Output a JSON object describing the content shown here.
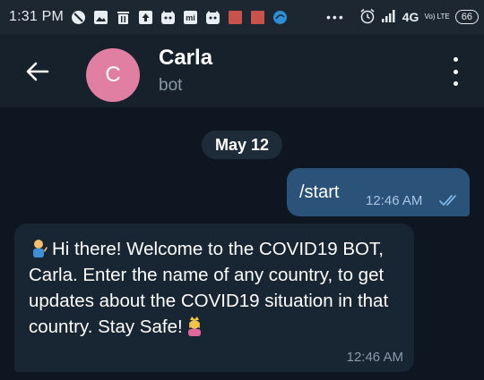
{
  "status_bar": {
    "time": "1:31 PM",
    "icons": [
      "blocked-icon",
      "gallery-icon",
      "trash-icon",
      "upload-icon",
      "cat-icon",
      "mi-icon",
      "cat-icon",
      "red-square-icon",
      "red-square-icon",
      "blue-circle-icon"
    ],
    "more": "•••",
    "network": "4G",
    "volte": "Vo) LTE",
    "battery": "66"
  },
  "header": {
    "avatar_letter": "C",
    "title": "Carla",
    "subtitle": "bot",
    "avatar_color": "#e17fa2"
  },
  "chat": {
    "date_chip": "May 12",
    "messages": [
      {
        "direction": "out",
        "text": "/start",
        "time": "12:46 AM",
        "status": "double-check-icon"
      },
      {
        "direction": "in",
        "text": "Hi there! Welcome to the COVID19 BOT, Carla. Enter the name of any country, to get updates about the COVID19 situation in that country. Stay Safe!",
        "time": "12:46 AM",
        "emojis": [
          "person-tipping-hand-emoji",
          "crown-princess-emoji"
        ]
      }
    ]
  },
  "colors": {
    "background": "#0e1621",
    "header": "#17212b",
    "outgoing_bubble": "#2b5278",
    "incoming_bubble": "#182533"
  }
}
